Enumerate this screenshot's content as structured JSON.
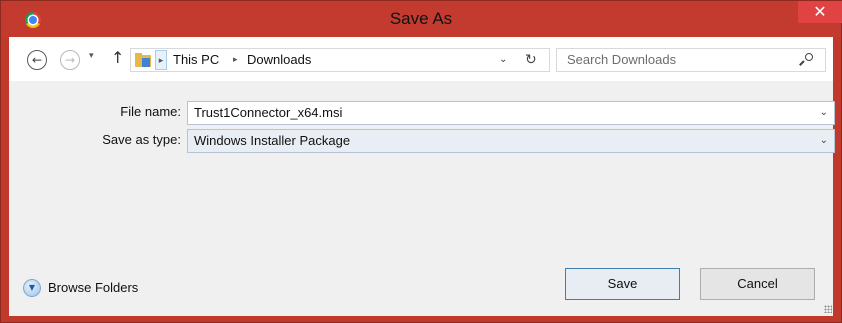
{
  "window": {
    "title": "Save As",
    "close_glyph": "✕"
  },
  "navigation": {
    "back_glyph": "←",
    "forward_glyph": "→",
    "recent_glyph": "▾",
    "up_glyph": "↑",
    "breadcrumb": [
      "This PC",
      "Downloads"
    ],
    "crumb_separator": "▸",
    "dropdown_glyph": "⌄",
    "refresh_glyph": "↻"
  },
  "search": {
    "placeholder": "Search Downloads"
  },
  "form": {
    "file_name_label": "File name:",
    "file_name_value": "Trust1Connector_x64.msi",
    "save_type_label": "Save as type:",
    "save_type_value": "Windows Installer Package",
    "chevron_glyph": "⌄"
  },
  "footer": {
    "browse_label": "Browse Folders",
    "browse_glyph": "▼",
    "save_label": "Save",
    "cancel_label": "Cancel"
  },
  "colors": {
    "titlebar": "#c33b2e",
    "close_button": "#e04343",
    "client_bg": "#f0f0f0",
    "primary_border": "#3c7fb1"
  },
  "icons": {
    "app": "chrome-icon",
    "folder": "folder-download-icon",
    "search": "search-icon",
    "browse": "expand-circle-icon"
  }
}
